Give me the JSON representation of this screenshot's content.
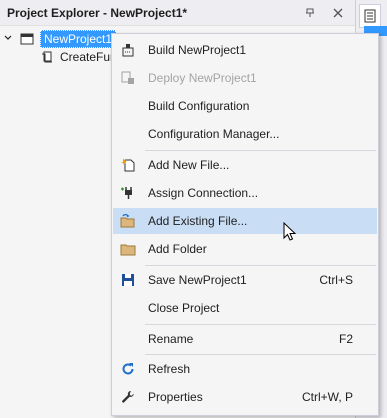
{
  "panel": {
    "title": "Project Explorer - NewProject1*",
    "pin_icon": "pin-icon",
    "close_icon": "close-icon"
  },
  "tree": {
    "project_label": "NewProject1",
    "child_label": "CreateFun"
  },
  "menu": {
    "build": "Build NewProject1",
    "deploy": "Deploy NewProject1",
    "build_config": "Build Configuration",
    "config_manager": "Configuration Manager...",
    "add_new_file": "Add New File...",
    "assign_connection": "Assign Connection...",
    "add_existing_file": "Add Existing File...",
    "add_folder": "Add Folder",
    "save": "Save NewProject1",
    "save_shortcut": "Ctrl+S",
    "close_project": "Close Project",
    "rename": "Rename",
    "rename_shortcut": "F2",
    "refresh": "Refresh",
    "properties": "Properties",
    "properties_shortcut": "Ctrl+W, P"
  },
  "colors": {
    "selection": "#3399ff",
    "hover": "#c9def5",
    "disabled_text": "#a2a4a5",
    "save_icon": "#1e4e9c",
    "refresh_icon": "#1e6fc9"
  }
}
